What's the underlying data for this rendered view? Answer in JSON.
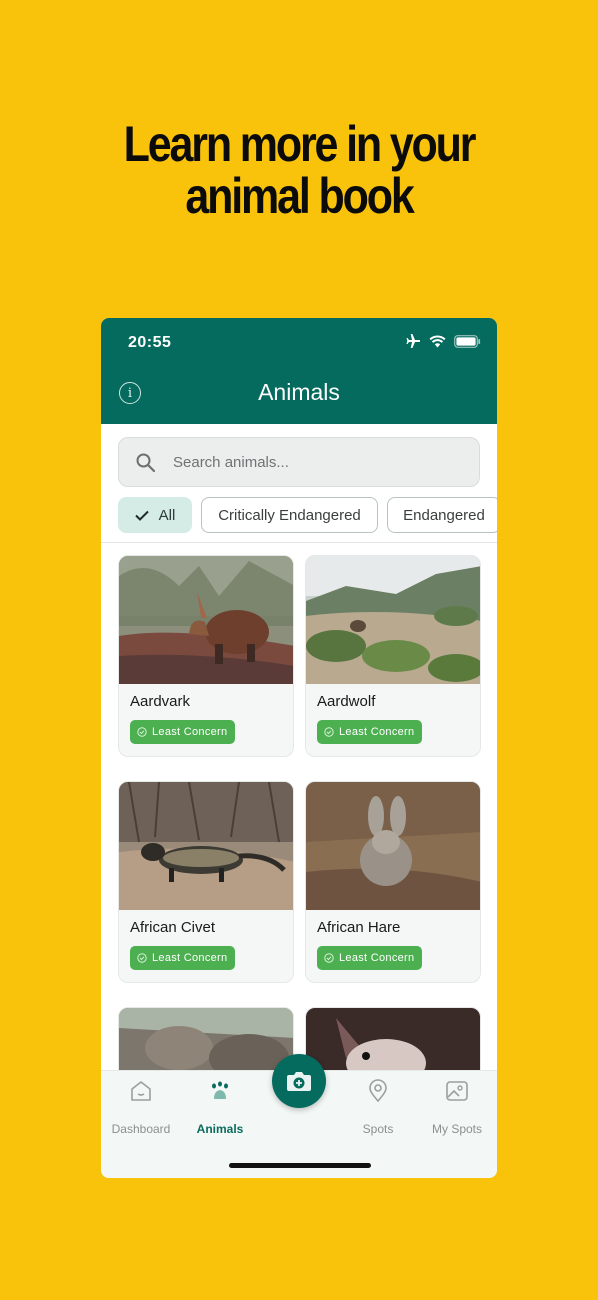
{
  "headline": {
    "line1": "Learn more in your",
    "line2": "animal book"
  },
  "status_bar": {
    "time": "20:55"
  },
  "app_bar": {
    "title": "Animals"
  },
  "search": {
    "placeholder": "Search animals..."
  },
  "filters": [
    {
      "label": "All",
      "selected": true
    },
    {
      "label": "Critically Endangered",
      "selected": false
    },
    {
      "label": "Endangered",
      "selected": false
    }
  ],
  "animals": [
    {
      "name": "Aardvark",
      "status": "Least Concern"
    },
    {
      "name": "Aardwolf",
      "status": "Least Concern"
    },
    {
      "name": "African Civet",
      "status": "Least Concern"
    },
    {
      "name": "African Hare",
      "status": "Least Concern"
    }
  ],
  "bottom_nav": [
    {
      "label": "Dashboard",
      "icon": "home-icon",
      "active": false
    },
    {
      "label": "Animals",
      "icon": "paw-icon",
      "active": true
    },
    {
      "label": "Spots",
      "icon": "location-pin-icon",
      "active": false
    },
    {
      "label": "My Spots",
      "icon": "gallery-icon",
      "active": false
    }
  ],
  "fab": {
    "icon": "camera-plus-icon"
  },
  "colors": {
    "background": "#FAC30B",
    "brand": "#056B5E",
    "badge": "#4CAF50",
    "chip_selected": "#D5EBE6"
  }
}
